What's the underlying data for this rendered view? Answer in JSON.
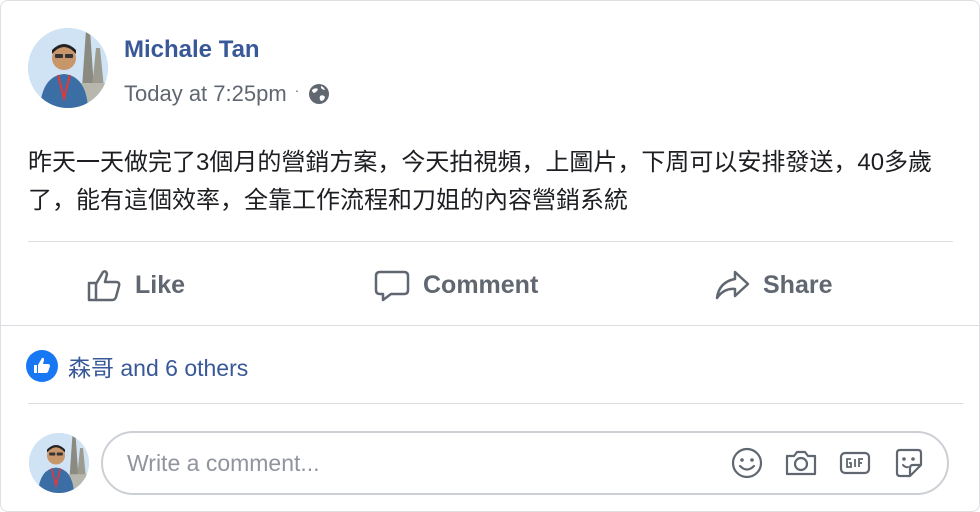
{
  "post": {
    "author": "Michale Tan",
    "timestamp": "Today at 7:25pm",
    "separator": "·",
    "privacy_icon": "globe-icon",
    "text": "昨天一天做完了3個月的營銷方案，今天拍視頻，上圖片，下周可以安排發送，40多歲了，能有這個效率，全靠工作流程和刀姐的內容營銷系統"
  },
  "actions": {
    "like_label": "Like",
    "comment_label": "Comment",
    "share_label": "Share"
  },
  "reactions": {
    "summary": "森哥 and 6 others",
    "icon": "like-reaction-icon"
  },
  "comment_box": {
    "placeholder": "Write a comment...",
    "icons": [
      "emoji-icon",
      "camera-icon",
      "gif-icon",
      "sticker-icon"
    ]
  },
  "colors": {
    "link_blue": "#385898",
    "like_blue": "#1877f2",
    "muted_text": "#606770",
    "divider": "#dadde1"
  }
}
